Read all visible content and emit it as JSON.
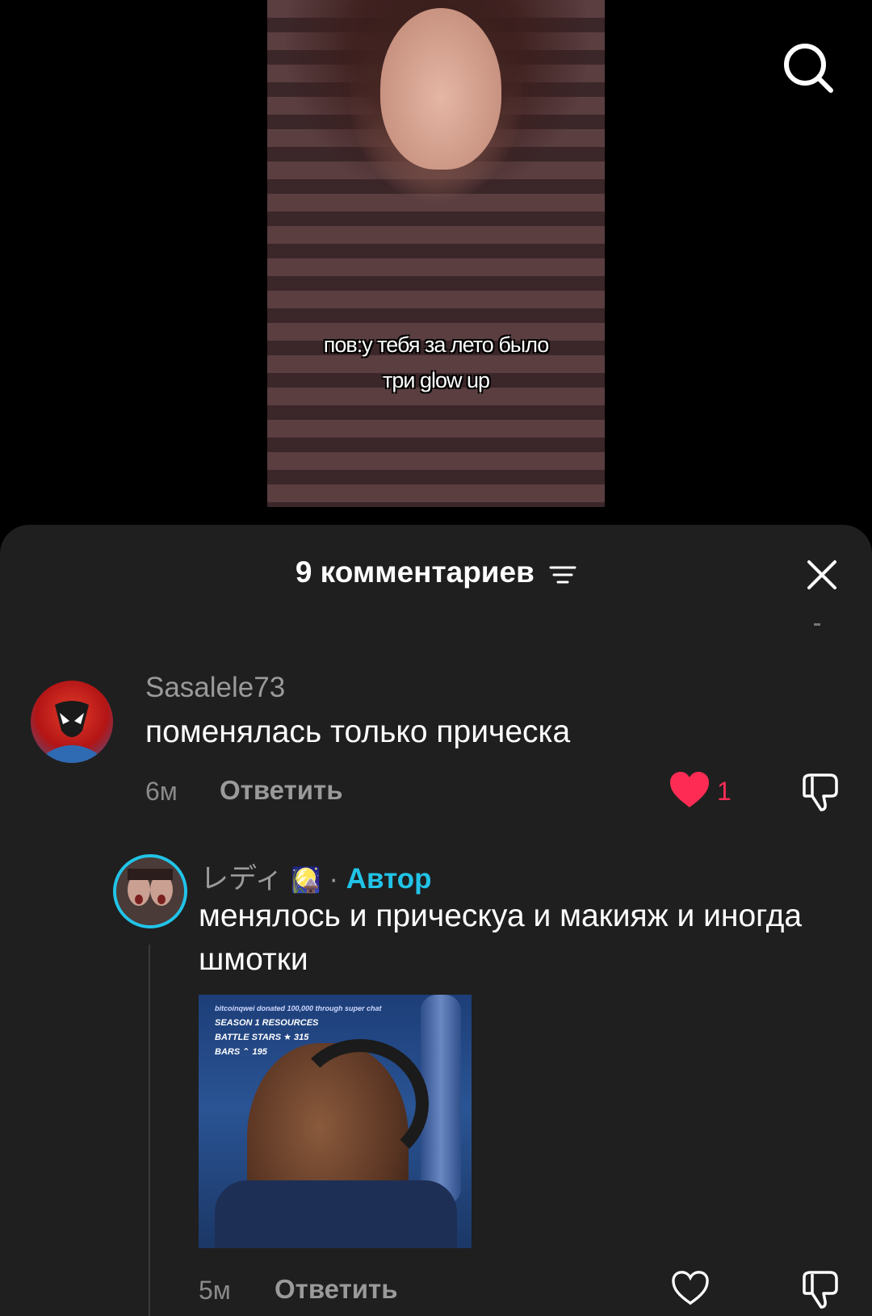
{
  "video": {
    "caption_line1": "пов:у тебя за лето было",
    "caption_line2": "три glow up"
  },
  "icons": {
    "search": "search-icon",
    "filter": "filter-icon",
    "close": "close-icon",
    "heart": "heart-icon",
    "dislike": "dislike-icon"
  },
  "colors": {
    "sheet_bg": "#1f1f1f",
    "like_red": "#fe2c55",
    "author_cyan": "#21c4e8",
    "muted_text": "#9a9a9a"
  },
  "comments_sheet": {
    "title": "9 комментариев"
  },
  "comment1": {
    "username": "Sasalele73",
    "text": "поменялась только прическа",
    "time": "6м",
    "reply_label": "Ответить",
    "like_count": "1",
    "liked": true
  },
  "comment2": {
    "username": "レディ",
    "emoji": "🎑",
    "separator": "·",
    "badge": "Автор",
    "text": "менялось и прическуа и макияж и иногда шмотки",
    "time": "5м",
    "reply_label": "Ответить",
    "liked": false,
    "gif": {
      "hud_line0": "bitcoinqwei donated 100,000 through super chat",
      "hud_line1": "SEASON 1 RESOURCES",
      "hud_line2": "BATTLE STARS ★ 315",
      "hud_line3": "BARS ⌃ 195"
    }
  }
}
